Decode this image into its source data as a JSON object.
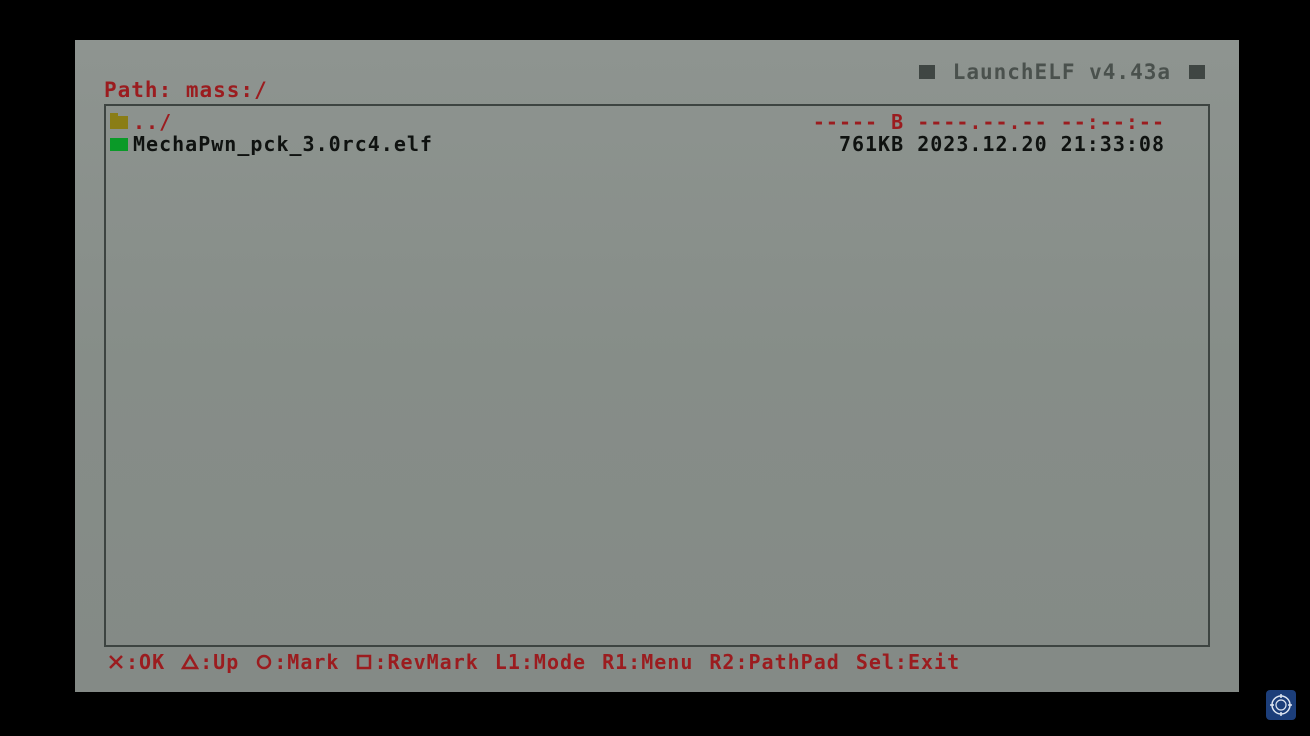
{
  "title": "LaunchELF v4.43a",
  "path": "Path: mass:/",
  "files": [
    {
      "name": "../",
      "size": "----- B",
      "date": "----.--.--",
      "time": "--:--:--",
      "type": "folder"
    },
    {
      "name": "MechaPwn_pck_3.0rc4.elf",
      "size": "761KB",
      "date": "2023.12.20",
      "time": "21:33:08",
      "type": "elf"
    }
  ],
  "controls": [
    {
      "icon": "cross-icon",
      "label": ":OK"
    },
    {
      "icon": "triangle-icon",
      "label": ":Up"
    },
    {
      "icon": "circle-icon",
      "label": ":Mark"
    },
    {
      "icon": "square-icon",
      "label": ":RevMark"
    },
    {
      "icon": "",
      "label": "L1:Mode"
    },
    {
      "icon": "",
      "label": "R1:Menu"
    },
    {
      "icon": "",
      "label": "R2:PathPad"
    },
    {
      "icon": "",
      "label": "Sel:Exit"
    }
  ],
  "colors": {
    "screen_bg": "#868d88",
    "accent_red": "#9b1c1f",
    "title_gray": "#4a514d",
    "folder_icon": "#8a7d16",
    "elf_icon": "#0a9a28"
  }
}
